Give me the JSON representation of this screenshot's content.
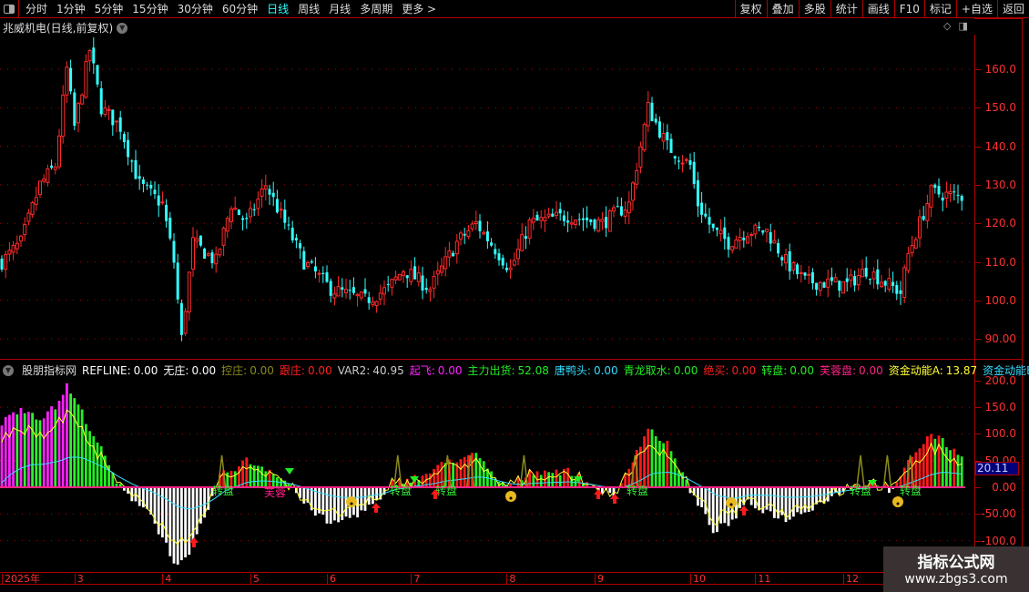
{
  "toolbar": {
    "periods": [
      "分时",
      "1分钟",
      "5分钟",
      "15分钟",
      "30分钟",
      "60分钟",
      "日线",
      "周线",
      "月线",
      "多周期",
      "更多 >"
    ],
    "active": "日线",
    "buttons": [
      "复权",
      "叠加",
      "多股",
      "统计",
      "画线",
      "F10",
      "标记",
      "+自选",
      "返回"
    ]
  },
  "title": "兆威机电(日线,前复权)",
  "price_axis": [
    "160.0",
    "150.0",
    "140.0",
    "130.0",
    "120.0",
    "110.0",
    "100.0",
    "90.00"
  ],
  "price_axis_values": [
    160,
    150,
    140,
    130,
    120,
    110,
    100,
    90
  ],
  "indicator": {
    "name": "股朋指标网",
    "fields": [
      {
        "label": "REFLINE:",
        "value": "0.00",
        "color": "#ffffff"
      },
      {
        "label": "无庄:",
        "value": "0.00",
        "color": "#ffffff"
      },
      {
        "label": "控庄:",
        "value": "0.00",
        "color": "#8a8a1a"
      },
      {
        "label": "跟庄:",
        "value": "0.00",
        "color": "#ff2020"
      },
      {
        "label": "VAR2:",
        "value": "40.95",
        "color": "#cccccc"
      },
      {
        "label": "起飞:",
        "value": "0.00",
        "color": "#ff22ff"
      },
      {
        "label": "主力出货:",
        "value": "52.08",
        "color": "#22ee22"
      },
      {
        "label": "唐鸭头:",
        "value": "0.00",
        "color": "#33ddff"
      },
      {
        "label": "青龙取水:",
        "value": "0.00",
        "color": "#22ee22"
      },
      {
        "label": "绝买:",
        "value": "0.00",
        "color": "#ff2020"
      },
      {
        "label": "转盘:",
        "value": "0.00",
        "color": "#22ee22"
      },
      {
        "label": "芙蓉盘:",
        "value": "0.00",
        "color": "#ff2288"
      },
      {
        "label": "资金动能A:",
        "value": "13.87",
        "color": "#ffff33"
      },
      {
        "label": "资金动能B:",
        "value": "",
        "color": "#33ddff"
      }
    ],
    "axis": [
      "200.0",
      "150.0",
      "100.0",
      "50.00",
      "0.00",
      "-50.00",
      "-100.0"
    ],
    "axis_values": [
      200,
      150,
      100,
      50,
      0,
      -50,
      -100
    ],
    "current_value": "20.11",
    "marker_zhuanpan": "转盘",
    "marker_furong": "芙蓉"
  },
  "dates": [
    "2025年",
    "3",
    "4",
    "5",
    "6",
    "7",
    "8",
    "9",
    "10",
    "11",
    "12"
  ],
  "date_index": [
    0,
    19,
    42,
    65,
    85,
    107,
    132,
    155,
    180,
    197,
    220
  ],
  "price_path": [
    [
      0,
      110
    ],
    [
      5,
      115
    ],
    [
      10,
      130
    ],
    [
      14,
      135
    ],
    [
      17,
      160
    ],
    [
      19,
      145
    ],
    [
      23,
      165
    ],
    [
      26,
      150
    ],
    [
      31,
      145
    ],
    [
      36,
      130
    ],
    [
      42,
      125
    ],
    [
      45,
      110
    ],
    [
      47,
      90
    ],
    [
      50,
      115
    ],
    [
      56,
      110
    ],
    [
      60,
      125
    ],
    [
      64,
      120
    ],
    [
      69,
      130
    ],
    [
      74,
      120
    ],
    [
      79,
      110
    ],
    [
      86,
      103
    ],
    [
      95,
      100
    ],
    [
      101,
      103
    ],
    [
      105,
      108
    ],
    [
      112,
      103
    ],
    [
      119,
      115
    ],
    [
      124,
      120
    ],
    [
      133,
      108
    ],
    [
      138,
      120
    ],
    [
      148,
      122
    ],
    [
      157,
      120
    ],
    [
      164,
      125
    ],
    [
      167,
      140
    ],
    [
      169,
      150
    ],
    [
      174,
      140
    ],
    [
      180,
      135
    ],
    [
      182,
      125
    ],
    [
      186,
      118
    ],
    [
      190,
      115
    ],
    [
      195,
      118
    ],
    [
      200,
      118
    ],
    [
      205,
      110
    ],
    [
      210,
      105
    ],
    [
      221,
      104
    ],
    [
      226,
      108
    ],
    [
      235,
      102
    ],
    [
      237,
      112
    ],
    [
      240,
      120
    ],
    [
      243,
      128
    ],
    [
      250,
      127
    ]
  ],
  "hist_path": [
    [
      0,
      120
    ],
    [
      5,
      150
    ],
    [
      10,
      130
    ],
    [
      14,
      150
    ],
    [
      17,
      190
    ],
    [
      21,
      140
    ],
    [
      26,
      70
    ],
    [
      30,
      10
    ],
    [
      32,
      -10
    ],
    [
      38,
      -40
    ],
    [
      46,
      -150
    ],
    [
      49,
      -130
    ],
    [
      55,
      -20
    ],
    [
      57,
      20
    ],
    [
      64,
      50
    ],
    [
      71,
      30
    ],
    [
      76,
      0
    ],
    [
      79,
      -30
    ],
    [
      86,
      -70
    ],
    [
      93,
      -50
    ],
    [
      100,
      -20
    ],
    [
      102,
      10
    ],
    [
      110,
      20
    ],
    [
      117,
      50
    ],
    [
      124,
      60
    ],
    [
      130,
      10
    ],
    [
      133,
      0
    ],
    [
      138,
      30
    ],
    [
      148,
      30
    ],
    [
      155,
      0
    ],
    [
      160,
      -20
    ],
    [
      164,
      40
    ],
    [
      169,
      110
    ],
    [
      174,
      80
    ],
    [
      179,
      10
    ],
    [
      181,
      -20
    ],
    [
      186,
      -80
    ],
    [
      190,
      -70
    ],
    [
      195,
      -30
    ],
    [
      205,
      -60
    ],
    [
      214,
      -30
    ],
    [
      221,
      0
    ],
    [
      229,
      10
    ],
    [
      233,
      -10
    ],
    [
      238,
      60
    ],
    [
      243,
      100
    ],
    [
      251,
      60
    ]
  ],
  "watermark": {
    "title": "指标公式网",
    "url": "www.zbgs3.com"
  },
  "colors": {
    "up": "#ff2a2a",
    "down": "#33ffff",
    "grid": "#b00000",
    "label": "#ff3030"
  }
}
